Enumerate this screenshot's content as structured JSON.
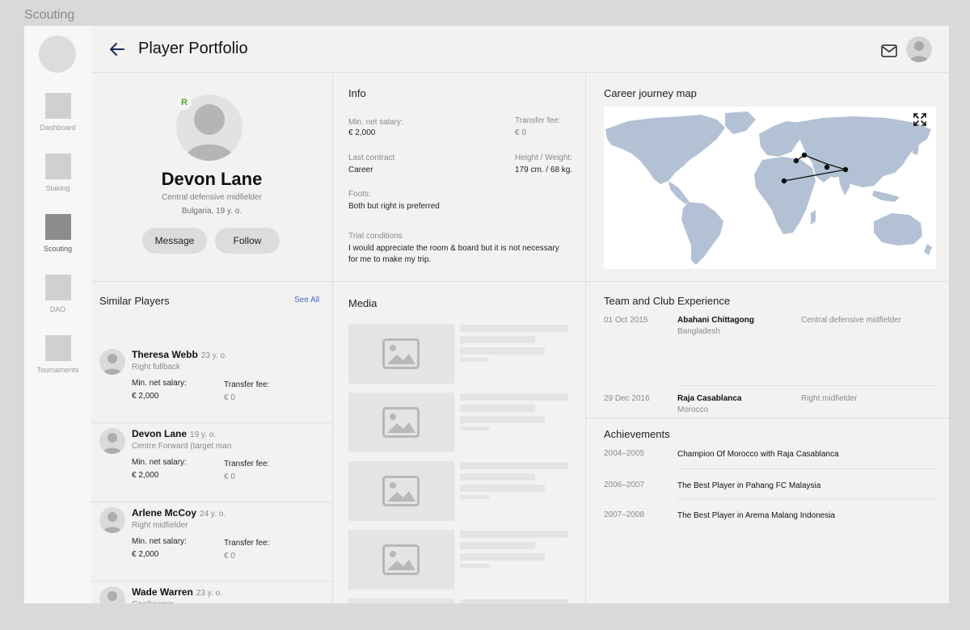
{
  "frame_label": "Scouting",
  "sidebar": {
    "items": [
      {
        "label": "Dashboard",
        "active": false
      },
      {
        "label": "Staking",
        "active": false
      },
      {
        "label": "Scouting",
        "active": true
      },
      {
        "label": "DAO",
        "active": false
      },
      {
        "label": "Tournaments",
        "active": false
      }
    ]
  },
  "header": {
    "title": "Player Portfolio",
    "back_icon": "arrow-left-icon",
    "mail_icon": "mail-icon"
  },
  "profile": {
    "badge": "R",
    "name": "Devon Lane",
    "role": "Central defensive midfielder",
    "origin": "Bulgaria, 19 y. o.",
    "message_label": "Message",
    "follow_label": "Follow"
  },
  "info": {
    "title": "Info",
    "salary_label": "Min. net salary:",
    "salary_value": "€ 2,000",
    "transfer_label": "Transfer fee:",
    "transfer_value": "€ 0",
    "contract_label": "Last contract",
    "contract_value": "Career",
    "height_label": "Height / Weight:",
    "height_value": "179 cm. / 68 kg.",
    "foots_label": "Foots:",
    "foots_value": "Both but right is preferred",
    "trial_label": "Trial conditions",
    "trial_value": "I would appreciate the room & board but it is not necessary for me to make my trip."
  },
  "map": {
    "title": "Career journey map",
    "expand_icon": "expand-icon",
    "land_color": "#b3c1d4",
    "route_color": "#111111"
  },
  "similar": {
    "title": "Similar Players",
    "see_all": "See All",
    "salary_label": "Min. net salary:",
    "fee_label": "Transfer fee:",
    "players": [
      {
        "name": "Theresa Webb",
        "age": "23 y. o.",
        "role": "Right fullback",
        "salary": "€ 2,000",
        "fee": "€ 0"
      },
      {
        "name": "Devon Lane",
        "age": "19 y. o.",
        "role": "Centre Forward (target man",
        "salary": "€ 2,000",
        "fee": "€ 0"
      },
      {
        "name": "Arlene McCoy",
        "age": "24 y. o.",
        "role": "Right midfielder",
        "salary": "€ 2,000",
        "fee": "€ 0"
      },
      {
        "name": "Wade Warren",
        "age": "23 y. o.",
        "role": "Goalkeeper",
        "salary": "",
        "fee": ""
      }
    ]
  },
  "media": {
    "title": "Media",
    "image_icon": "image-placeholder-icon"
  },
  "experience": {
    "title": "Team and Club Experience",
    "rows": [
      {
        "date": "01 Oct 2015",
        "club": "Abahani Chittagong",
        "country": "Bangladesh",
        "position": "Central defensive midfielder"
      },
      {
        "date": "29 Dec 2016",
        "club": "Raja Casablanca",
        "country": "Morocco",
        "position": "Right midfielder"
      }
    ]
  },
  "achievements": {
    "title": "Achievements",
    "rows": [
      {
        "years": "2004–2005",
        "text": "Champion Of Morocco with Raja Casablanca"
      },
      {
        "years": "2006–2007",
        "text": "The Best Player in Pahang FC Malaysia"
      },
      {
        "years": "2007–2008",
        "text": "The Best Player in Arema Malang Indonesia"
      }
    ]
  }
}
